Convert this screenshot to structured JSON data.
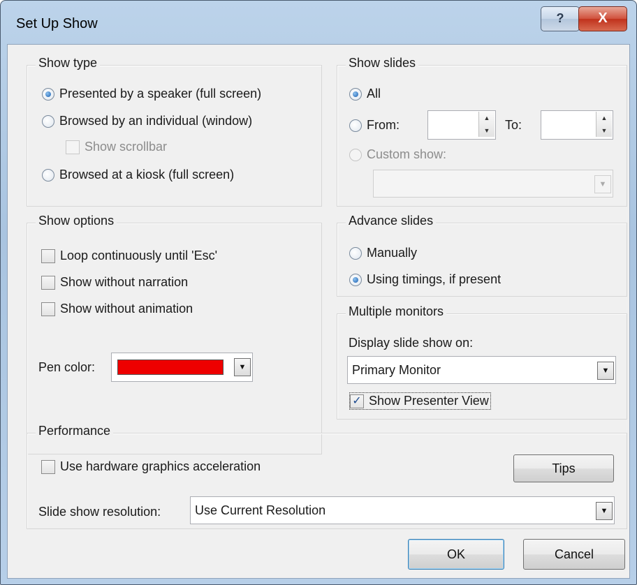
{
  "window": {
    "title": "Set Up Show",
    "help_label": "?",
    "close_label": "X"
  },
  "show_type": {
    "title": "Show type",
    "options": [
      {
        "label": "Presented by a speaker (full screen)",
        "selected": true
      },
      {
        "label": "Browsed by an individual (window)",
        "selected": false
      },
      {
        "label": "Browsed at a kiosk (full screen)",
        "selected": false
      }
    ],
    "show_scrollbar": {
      "label": "Show scrollbar",
      "checked": false,
      "enabled": false
    }
  },
  "show_slides": {
    "title": "Show slides",
    "all_label": "All",
    "from_label": "From:",
    "from_value": "",
    "to_label": "To:",
    "to_value": "",
    "custom_show_label": "Custom show:",
    "custom_show_value": ""
  },
  "show_options": {
    "title": "Show options",
    "checkboxes": [
      {
        "label": "Loop continuously until 'Esc'",
        "checked": false
      },
      {
        "label": "Show without narration",
        "checked": false
      },
      {
        "label": "Show without animation",
        "checked": false
      }
    ],
    "pen_color_label": "Pen color:",
    "pen_color": "#ee0000"
  },
  "advance_slides": {
    "title": "Advance slides",
    "options": [
      {
        "label": "Manually",
        "selected": false
      },
      {
        "label": "Using timings, if present",
        "selected": true
      }
    ]
  },
  "multiple_monitors": {
    "title": "Multiple monitors",
    "display_label": "Display slide show on:",
    "display_value": "Primary Monitor",
    "presenter_view_label": "Show Presenter View",
    "presenter_view_checked": true
  },
  "performance": {
    "title": "Performance",
    "hw_accel_label": "Use hardware graphics acceleration",
    "hw_accel_checked": false,
    "tips_label": "Tips",
    "resolution_label": "Slide show resolution:",
    "resolution_value": "Use Current Resolution"
  },
  "buttons": {
    "ok_label": "OK",
    "cancel_label": "Cancel"
  }
}
